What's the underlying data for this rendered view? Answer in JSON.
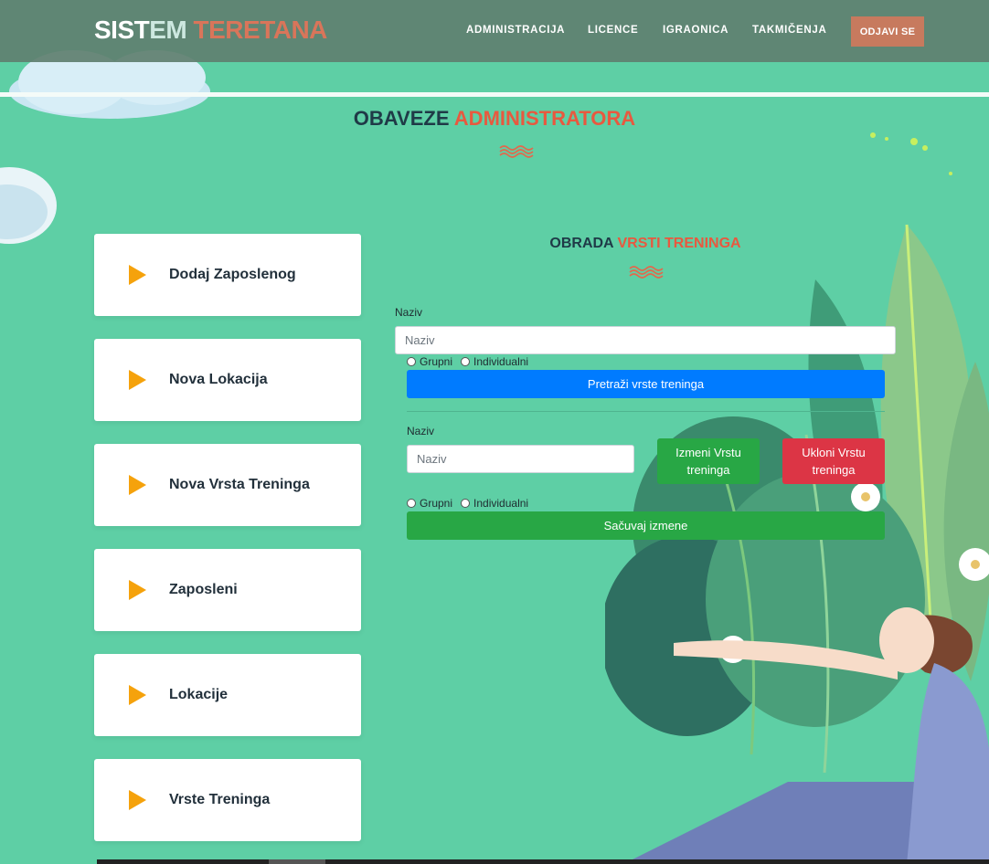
{
  "navbar": {
    "brand_part1": "SIST",
    "brand_part2": "EM",
    "brand_part3": "TERETANA",
    "links": [
      {
        "label": "ADMINISTRACIJA"
      },
      {
        "label": "LICENCE"
      },
      {
        "label": "IGRAONICA"
      },
      {
        "label": "TAKMIČENJA"
      }
    ],
    "logout_label": "ODJAVI SE"
  },
  "page_title": {
    "part1": "OBAVEZE",
    "part2": "ADMINISTRATORA"
  },
  "menu": {
    "items": [
      {
        "label": "Dodaj Zaposlenog",
        "icon": "play-icon"
      },
      {
        "label": "Nova Lokacija",
        "icon": "play-icon"
      },
      {
        "label": "Nova Vrsta Treninga",
        "icon": "play-icon"
      },
      {
        "label": "Zaposleni",
        "icon": "play-icon"
      },
      {
        "label": "Lokacije",
        "icon": "play-icon"
      },
      {
        "label": "Vrste Treninga",
        "icon": "play-icon"
      }
    ]
  },
  "form": {
    "title_part1": "OBRADA",
    "title_part2": "VRSTI TRENINGA",
    "search": {
      "label": "Naziv",
      "placeholder": "Naziv",
      "radio_group": "Grupni",
      "radio_individual": "Individualni",
      "button": "Pretraži vrste treninga"
    },
    "edit": {
      "label": "Naziv",
      "placeholder": "Naziv",
      "update_button": "Izmeni Vrstu treninga",
      "delete_button": "Ukloni Vrstu treninga",
      "radio_group": "Grupni",
      "radio_individual": "Individualni",
      "save_button": "Sačuvaj izmene"
    }
  },
  "colors": {
    "background": "#5ecfa5",
    "accent": "#e8593f",
    "heading": "#1f3a47",
    "primary": "#007bff",
    "success": "#28a745",
    "danger": "#dc3545",
    "play_icon": "#f5a20c"
  }
}
